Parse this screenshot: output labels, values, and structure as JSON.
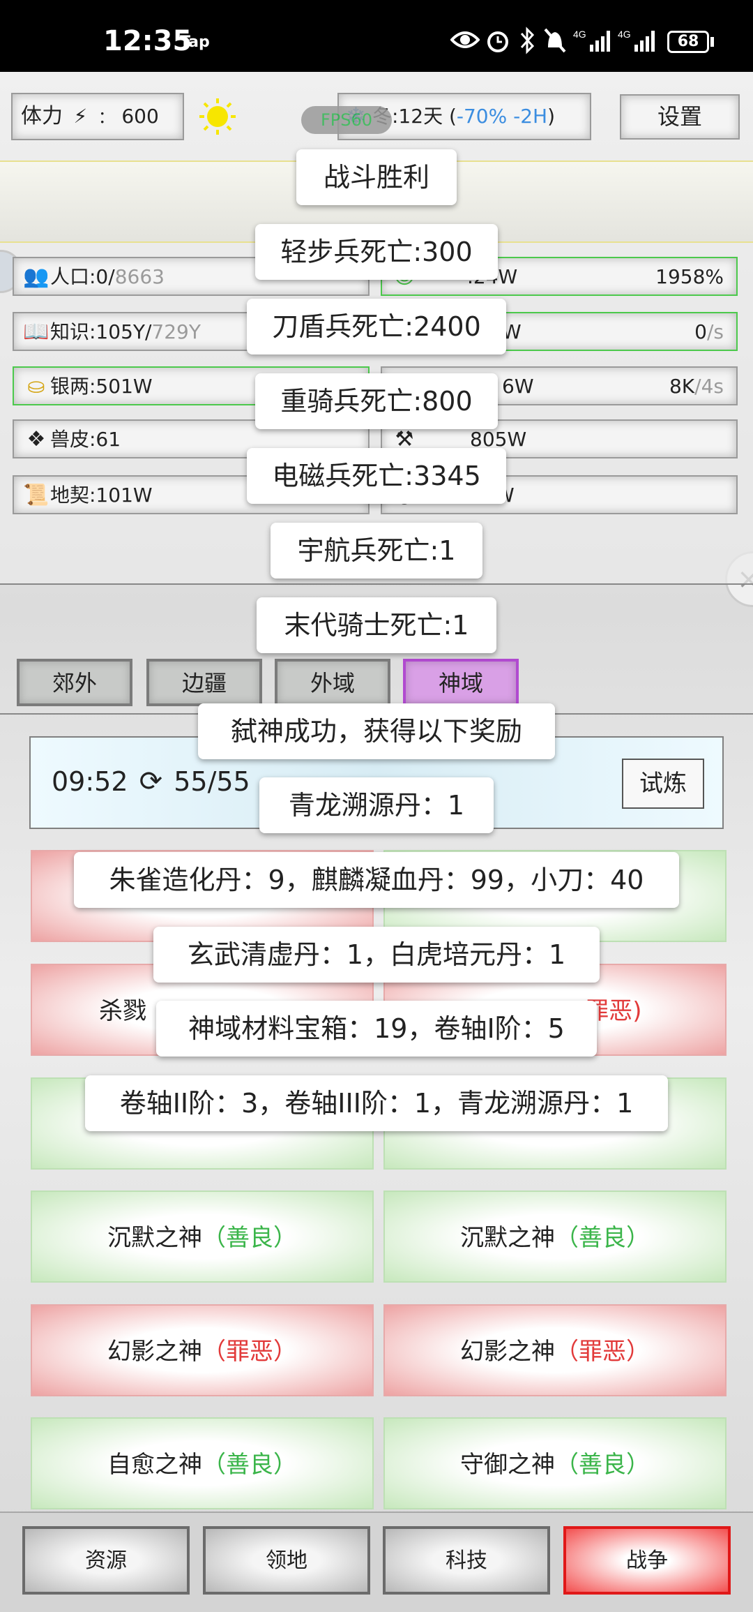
{
  "status_bar": {
    "time": "12:35",
    "tap": "Tap",
    "battery": "68"
  },
  "top": {
    "stamina_label": "体力",
    "stamina_sep": "：",
    "stamina_value": "600",
    "fps_label": "FPS60",
    "season_text": "冬:12天 (",
    "season_modifier": "-70% -2H",
    "season_close": ")",
    "settings_label": "设置"
  },
  "resources_left": [
    {
      "icon": "people-icon",
      "label": "人口:0/",
      "extra": "8663"
    },
    {
      "icon": "book-icon",
      "label": "知识:105Y/",
      "extra": "729Y"
    },
    {
      "icon": "silver-ingot-icon",
      "label": "银两:501W",
      "extra": ""
    },
    {
      "icon": "beast-hide-icon",
      "label": "兽皮:61",
      "extra": ""
    },
    {
      "icon": "deed-scroll-icon",
      "label": "地契:101W",
      "extra": ""
    }
  ],
  "resources_right": [
    {
      "label": ".24W",
      "value": "1958%",
      "unit": ""
    },
    {
      "label": "W",
      "value": "0",
      "unit": "/s"
    },
    {
      "label": "6W",
      "value": "8K",
      "unit": "/4s"
    },
    {
      "label": "805W",
      "value": "",
      "unit": ""
    },
    {
      "label": "W",
      "value": "",
      "unit": ""
    }
  ],
  "tabs": [
    "郊外",
    "边疆",
    "外域",
    "神域"
  ],
  "trial": {
    "time": "09:52",
    "count": "55/55",
    "button": "试炼"
  },
  "gods": [
    {
      "name": "杀戮",
      "tag": "",
      "type": "evil"
    },
    {
      "name": "",
      "tag": "(罪恶)",
      "type": "evil"
    },
    {
      "name": "",
      "tag": "",
      "type": "good"
    },
    {
      "name": "",
      "tag": "",
      "type": "good"
    },
    {
      "name": "沉默之神",
      "tag": "（善良）",
      "type": "good"
    },
    {
      "name": "沉默之神",
      "tag": "（善良）",
      "type": "good"
    },
    {
      "name": "幻影之神",
      "tag": "（罪恶）",
      "type": "evil"
    },
    {
      "name": "幻影之神",
      "tag": "（罪恶）",
      "type": "evil"
    },
    {
      "name": "自愈之神",
      "tag": "（善良）",
      "type": "good"
    },
    {
      "name": "守御之神",
      "tag": "（善良）",
      "type": "good"
    }
  ],
  "popups": [
    "战斗胜利",
    "轻步兵死亡:300",
    "刀盾兵死亡:2400",
    "重骑兵死亡:800",
    "电磁兵死亡:3345",
    "宇航兵死亡:1",
    "末代骑士死亡:1",
    "弑神成功，获得以下奖励",
    "青龙溯源丹：1",
    "朱雀造化丹：9，麒麟凝血丹：99，小刀：40",
    "玄武清虚丹：1，白虎培元丹：1",
    "神域材料宝箱：19，卷轴I阶：5",
    "卷轴II阶：3，卷轴III阶：1，青龙溯源丹：1"
  ],
  "bottom_nav": [
    "资源",
    "领地",
    "科技",
    "战争"
  ],
  "colors": {
    "good": "#3bb54a",
    "evil": "#e23a3a",
    "fps": "#2bb24c",
    "season_mod": "#3b8de0",
    "tab_active": "#d9a0e6"
  }
}
